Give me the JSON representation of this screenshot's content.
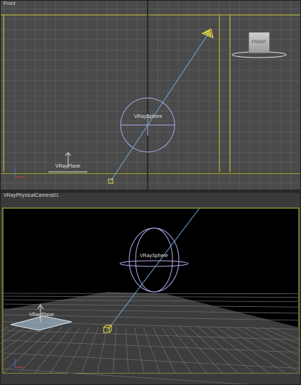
{
  "viewports": {
    "top": {
      "label": "Front"
    },
    "bottom": {
      "label": "VRayPhysicalCamera01"
    }
  },
  "objects": {
    "sphere_label": "VRaySphere",
    "plane_label": "VRayPlane"
  },
  "viewcube": {
    "face_label": "FRONT",
    "icon": "viewcube-icon"
  },
  "icons": {
    "axis_tripod": "axis-tripod-icon",
    "camera": "camera-icon",
    "camera_target": "camera-target-icon"
  },
  "colors": {
    "grid": "#5e5e5e",
    "grid_major": "#2a2a2a",
    "active_border": "#c8c839",
    "wire_sphere": "#b9a9ee",
    "camera_line": "#6aa8d8",
    "camera_yellow": "#f0e040"
  }
}
